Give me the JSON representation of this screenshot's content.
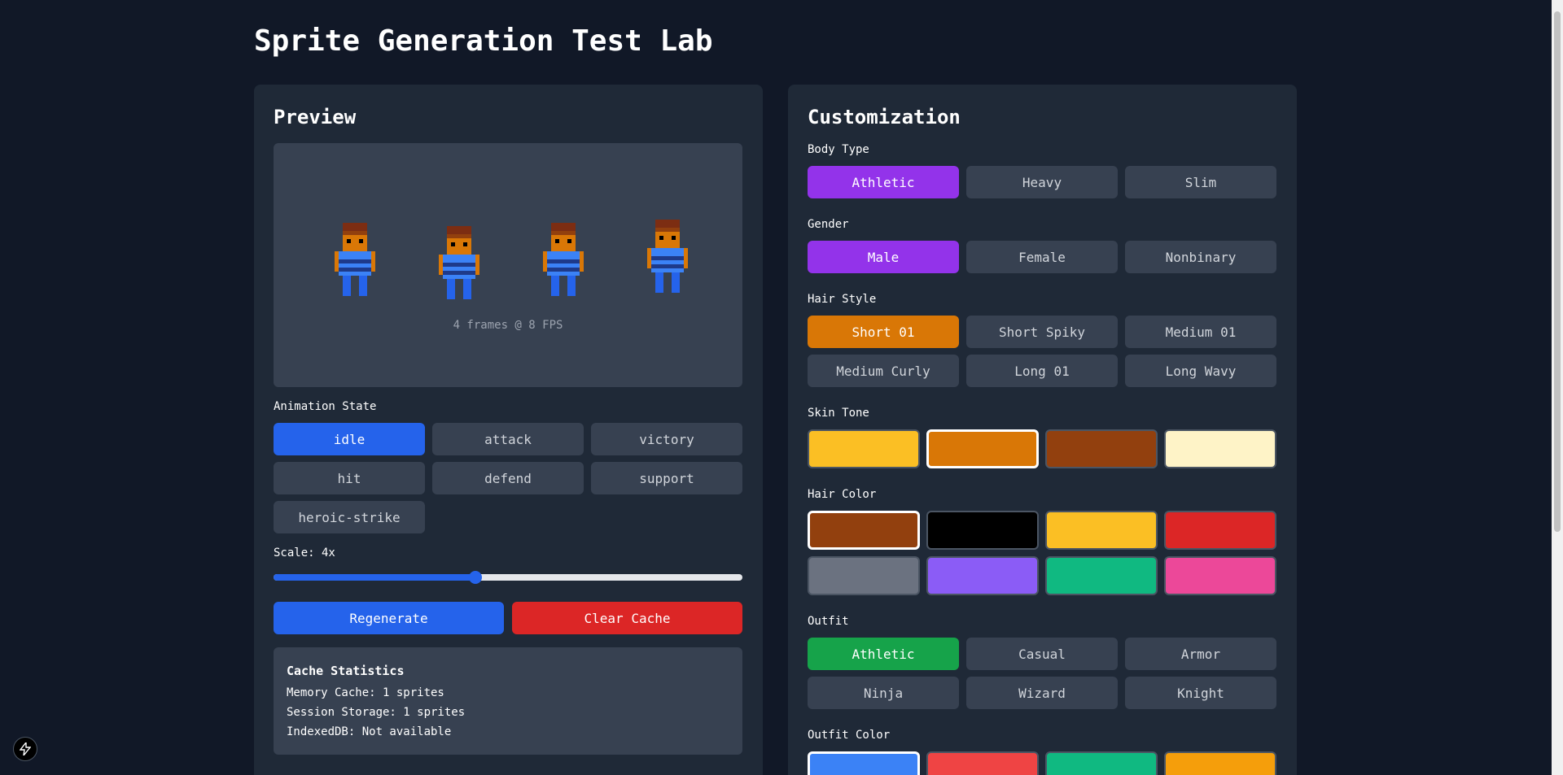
{
  "page": {
    "title": "Sprite Generation Test Lab"
  },
  "preview": {
    "heading": "Preview",
    "fps_text": "4 frames @ 8 FPS",
    "animation_label": "Animation State",
    "states": [
      "idle",
      "attack",
      "victory",
      "hit",
      "defend",
      "support",
      "heroic-strike"
    ],
    "selected_state": "idle",
    "scale_label": "Scale: 4x",
    "scale_fraction": 0.43,
    "regenerate_label": "Regenerate",
    "clear_cache_label": "Clear Cache"
  },
  "cache_stats": {
    "title": "Cache Statistics",
    "memory": "Memory Cache: 1 sprites",
    "session": "Session Storage: 1 sprites",
    "indexeddb": "IndexedDB: Not available"
  },
  "customization": {
    "heading": "Customization",
    "body_type_label": "Body Type",
    "body_types": [
      "Athletic",
      "Heavy",
      "Slim"
    ],
    "gender_label": "Gender",
    "genders": [
      "Male",
      "Female",
      "Nonbinary"
    ],
    "hair_style_label": "Hair Style",
    "hair_styles": [
      "Short 01",
      "Short Spiky",
      "Medium 01",
      "Medium Curly",
      "Long 01",
      "Long Wavy"
    ],
    "skin_tone_label": "Skin Tone",
    "skin_tones": [
      "#fbbf24",
      "#d97706",
      "#92400e",
      "#fef3c7"
    ],
    "skin_selected_index": 1,
    "hair_color_label": "Hair Color",
    "hair_colors": [
      "#92400e",
      "#000000",
      "#fbbf24",
      "#dc2626",
      "#6b7280",
      "#8b5cf6",
      "#10b981",
      "#ec4899"
    ],
    "hair_selected_index": 0,
    "outfit_label": "Outfit",
    "outfits": [
      "Athletic",
      "Casual",
      "Armor",
      "Ninja",
      "Wizard",
      "Knight"
    ],
    "outfit_color_label": "Outfit Color",
    "outfit_colors": [
      "#3b82f6",
      "#ef4444",
      "#10b981",
      "#f59e0b"
    ],
    "outfit_color_selected_index": 0
  },
  "colors": {
    "accent_blue": "#2563eb",
    "accent_red": "#dc2626",
    "accent_purple": "#9333ea",
    "accent_orange": "#d97706",
    "accent_green": "#16a34a"
  }
}
